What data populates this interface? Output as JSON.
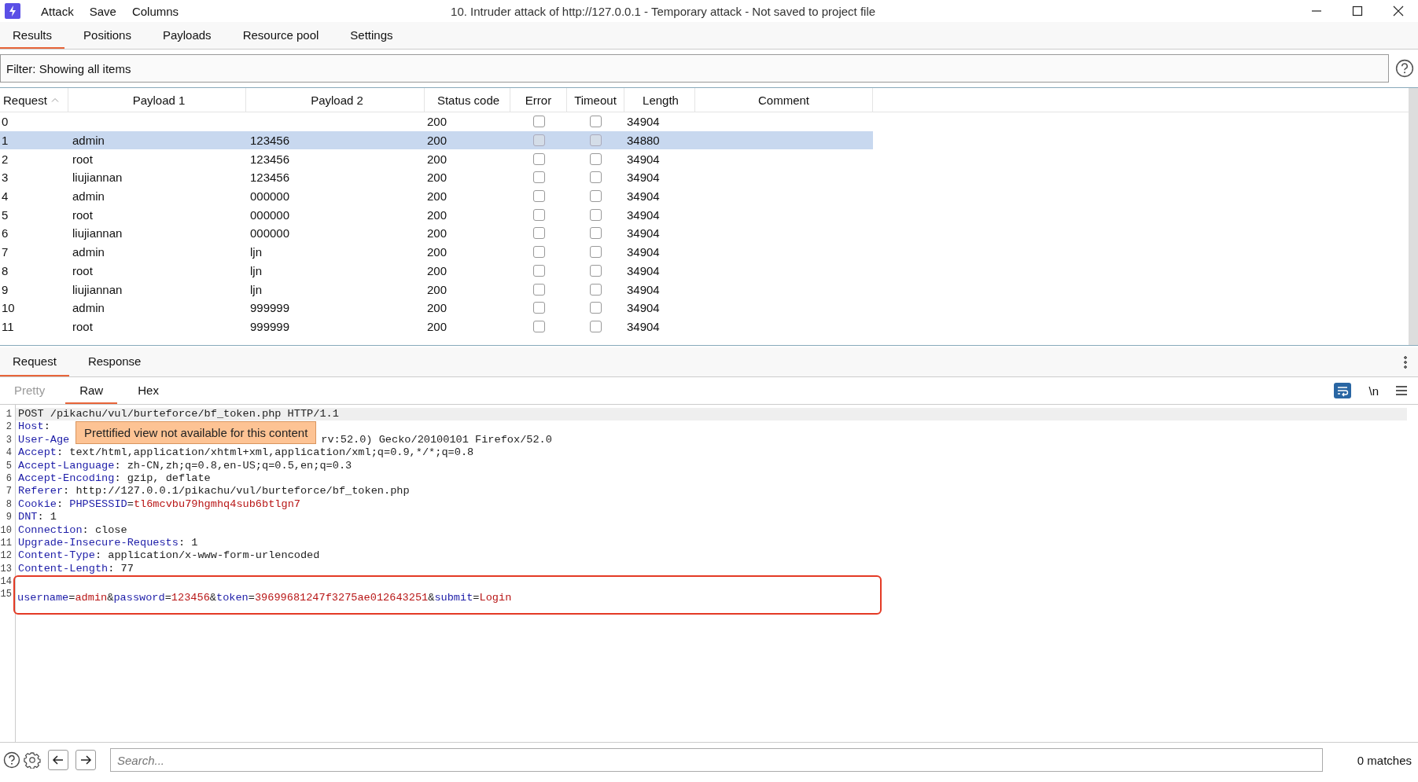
{
  "window": {
    "title": "10. Intruder attack of http://127.0.0.1 - Temporary attack - Not saved to project file",
    "menu": [
      "Attack",
      "Save",
      "Columns"
    ]
  },
  "tabs": [
    {
      "label": "Results",
      "selected": true
    },
    {
      "label": "Positions",
      "selected": false
    },
    {
      "label": "Payloads",
      "selected": false
    },
    {
      "label": "Resource pool",
      "selected": false
    },
    {
      "label": "Settings",
      "selected": false
    }
  ],
  "filter": {
    "label": "Filter: Showing all items"
  },
  "table": {
    "columns": [
      "Request",
      "Payload 1",
      "Payload 2",
      "Status code",
      "Error",
      "Timeout",
      "Length",
      "Comment"
    ],
    "rows": [
      {
        "request": "0",
        "status": "200",
        "error": false,
        "timeout": false,
        "length": "34904",
        "selected": false
      },
      {
        "request": "1",
        "payload_1": "admin",
        "payload_2": "123456",
        "status": "200",
        "error": false,
        "timeout": false,
        "length": "34880",
        "selected": true
      },
      {
        "request": "2",
        "payload_1": "root",
        "payload_2": "123456",
        "status": "200",
        "error": false,
        "timeout": false,
        "length": "34904",
        "selected": false
      },
      {
        "request": "3",
        "payload_1": "liujiannan",
        "payload_2": "123456",
        "status": "200",
        "error": false,
        "timeout": false,
        "length": "34904",
        "selected": false
      },
      {
        "request": "4",
        "payload_1": "admin",
        "payload_2": "000000",
        "status": "200",
        "error": false,
        "timeout": false,
        "length": "34904",
        "selected": false
      },
      {
        "request": "5",
        "payload_1": "root",
        "payload_2": "000000",
        "status": "200",
        "error": false,
        "timeout": false,
        "length": "34904",
        "selected": false
      },
      {
        "request": "6",
        "payload_1": "liujiannan",
        "payload_2": "000000",
        "status": "200",
        "error": false,
        "timeout": false,
        "length": "34904",
        "selected": false
      },
      {
        "request": "7",
        "payload_1": "admin",
        "payload_2": "ljn",
        "status": "200",
        "error": false,
        "timeout": false,
        "length": "34904",
        "selected": false
      },
      {
        "request": "8",
        "payload_1": "root",
        "payload_2": "ljn",
        "status": "200",
        "error": false,
        "timeout": false,
        "length": "34904",
        "selected": false
      },
      {
        "request": "9",
        "payload_1": "liujiannan",
        "payload_2": "ljn",
        "status": "200",
        "error": false,
        "timeout": false,
        "length": "34904",
        "selected": false
      },
      {
        "request": "10",
        "payload_1": "admin",
        "payload_2": "999999",
        "status": "200",
        "error": false,
        "timeout": false,
        "length": "34904",
        "selected": false
      },
      {
        "request": "11",
        "payload_1": "root",
        "payload_2": "999999",
        "status": "200",
        "error": false,
        "timeout": false,
        "length": "34904",
        "selected": false
      }
    ]
  },
  "detail_tabs": [
    {
      "label": "Request",
      "selected": true
    },
    {
      "label": "Response",
      "selected": false
    }
  ],
  "view_tabs": [
    {
      "label": "Pretty",
      "selected": false,
      "disabled": true
    },
    {
      "label": "Raw",
      "selected": true,
      "disabled": false
    },
    {
      "label": "Hex",
      "selected": false,
      "disabled": false
    }
  ],
  "view_options": {
    "wrap_on": true,
    "newline_label": "\\n"
  },
  "editor": {
    "tooltip": "Prettified view not available for this content",
    "lines": [
      {
        "number": "1",
        "highlighted": true,
        "segments": [
          {
            "kind": "plain",
            "text": "POST /pikachu/vul/burteforce/bf_token.php HTTP/1.1"
          }
        ]
      },
      {
        "number": "2",
        "highlighted": false,
        "segments": [
          {
            "kind": "key",
            "text": "Host"
          },
          {
            "kind": "plain",
            "text": ":"
          }
        ]
      },
      {
        "number": "3",
        "highlighted": false,
        "segments": [
          {
            "kind": "key",
            "text": "User-Age"
          },
          {
            "kind": "gap"
          },
          {
            "kind": "plain",
            "text": "rv:52.0) Gecko/20100101 Firefox/52.0"
          }
        ]
      },
      {
        "number": "4",
        "highlighted": false,
        "segments": [
          {
            "kind": "key",
            "text": "Accept"
          },
          {
            "kind": "plain",
            "text": ": text/html,application/xhtml+xml,application/xml;q=0.9,*/*;q=0.8"
          }
        ]
      },
      {
        "number": "5",
        "highlighted": false,
        "segments": [
          {
            "kind": "key",
            "text": "Accept-Language"
          },
          {
            "kind": "plain",
            "text": ": zh-CN,zh;q=0.8,en-US;q=0.5,en;q=0.3"
          }
        ]
      },
      {
        "number": "6",
        "highlighted": false,
        "segments": [
          {
            "kind": "key",
            "text": "Accept-Encoding"
          },
          {
            "kind": "plain",
            "text": ": gzip, deflate"
          }
        ]
      },
      {
        "number": "7",
        "highlighted": false,
        "segments": [
          {
            "kind": "key",
            "text": "Referer"
          },
          {
            "kind": "plain",
            "text": ": http://127.0.0.1/pikachu/vul/burteforce/bf_token.php"
          }
        ]
      },
      {
        "number": "8",
        "highlighted": false,
        "segments": [
          {
            "kind": "key",
            "text": "Cookie"
          },
          {
            "kind": "plain",
            "text": ": "
          },
          {
            "kind": "key",
            "text": "PHPSESSID"
          },
          {
            "kind": "plain",
            "text": "="
          },
          {
            "kind": "value",
            "text": "tl6mcvbu79hgmhq4sub6btlgn7"
          }
        ]
      },
      {
        "number": "9",
        "highlighted": false,
        "segments": [
          {
            "kind": "key",
            "text": "DNT"
          },
          {
            "kind": "plain",
            "text": ": 1"
          }
        ]
      },
      {
        "number": "10",
        "highlighted": false,
        "segments": [
          {
            "kind": "key",
            "text": "Connection"
          },
          {
            "kind": "plain",
            "text": ": close"
          }
        ]
      },
      {
        "number": "11",
        "highlighted": false,
        "segments": [
          {
            "kind": "key",
            "text": "Upgrade-Insecure-Requests"
          },
          {
            "kind": "plain",
            "text": ": 1"
          }
        ]
      },
      {
        "number": "12",
        "highlighted": false,
        "segments": [
          {
            "kind": "key",
            "text": "Content-Type"
          },
          {
            "kind": "plain",
            "text": ": application/x-www-form-urlencoded"
          }
        ]
      },
      {
        "number": "13",
        "highlighted": false,
        "segments": [
          {
            "kind": "key",
            "text": "Content-Length"
          },
          {
            "kind": "plain",
            "text": ": 77"
          }
        ]
      },
      {
        "number": "14",
        "highlighted": false,
        "marked": true
      },
      {
        "number": "15",
        "highlighted": false,
        "marked": true,
        "segments": [
          {
            "kind": "key",
            "text": "username"
          },
          {
            "kind": "plain",
            "text": "="
          },
          {
            "kind": "value",
            "text": "admin"
          },
          {
            "kind": "plain",
            "text": "&"
          },
          {
            "kind": "key",
            "text": "password"
          },
          {
            "kind": "plain",
            "text": "="
          },
          {
            "kind": "value",
            "text": "123456"
          },
          {
            "kind": "plain",
            "text": "&"
          },
          {
            "kind": "key",
            "text": "token"
          },
          {
            "kind": "plain",
            "text": "="
          },
          {
            "kind": "value",
            "text": "39699681247f3275ae012643251"
          },
          {
            "kind": "plain",
            "text": "&"
          },
          {
            "kind": "key",
            "text": "submit"
          },
          {
            "kind": "plain",
            "text": "="
          },
          {
            "kind": "value",
            "text": "Login"
          }
        ]
      }
    ]
  },
  "search": {
    "placeholder": "Search...",
    "matches": "0 matches"
  }
}
